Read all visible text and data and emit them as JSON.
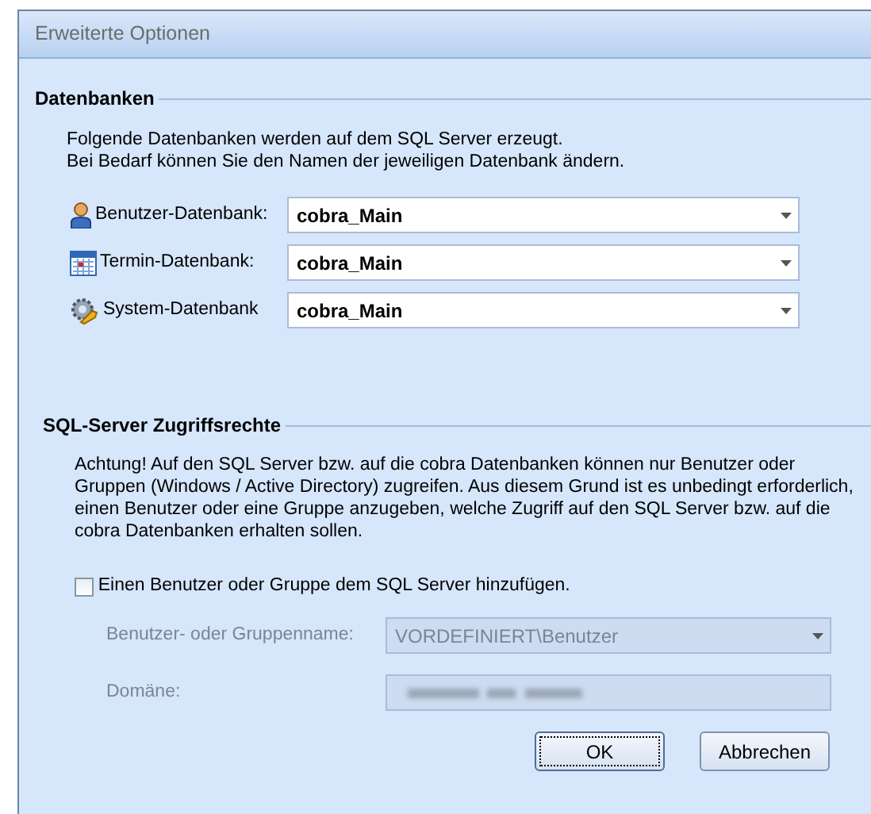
{
  "window": {
    "title": "Erweiterte Optionen"
  },
  "databases": {
    "heading": "Datenbanken",
    "intro": [
      "Folgende Datenbanken werden auf dem SQL Server erzeugt.",
      "Bei Bedarf können Sie den Namen der jeweiligen Datenbank ändern."
    ],
    "rows": [
      {
        "kind": "user",
        "label": "Benutzer-Datenbank:",
        "value": "cobra_Main"
      },
      {
        "kind": "calendar",
        "label": "Termin-Datenbank:",
        "value": "cobra_Main"
      },
      {
        "kind": "system",
        "label": "System-Datenbank",
        "value": "cobra_Main"
      }
    ]
  },
  "access": {
    "heading": "SQL-Server Zugriffsrechte",
    "note": "Achtung! Auf den SQL Server bzw. auf die cobra Datenbanken können nur Benutzer oder Gruppen (Windows / Active Directory) zugreifen.  Aus diesem Grund ist es unbedingt erforderlich, einen Benutzer oder eine Gruppe anzugeben, welche Zugriff auf den SQL Server bzw. auf die cobra Datenbanken erhalten sollen.",
    "checkbox": {
      "label": "Einen Benutzer oder Gruppe dem SQL Server hinzufügen.",
      "checked": false
    },
    "fields": [
      {
        "kind": "combo",
        "label": "Benutzer- oder Gruppenname:",
        "value": "VORDEFINIERT\\Benutzer",
        "disabled": true
      },
      {
        "kind": "blurred",
        "label": "Domäne:",
        "disabled": true
      }
    ]
  },
  "buttons": [
    {
      "label": "OK",
      "focused": true
    },
    {
      "label": "Abbrechen",
      "focused": false
    }
  ]
}
